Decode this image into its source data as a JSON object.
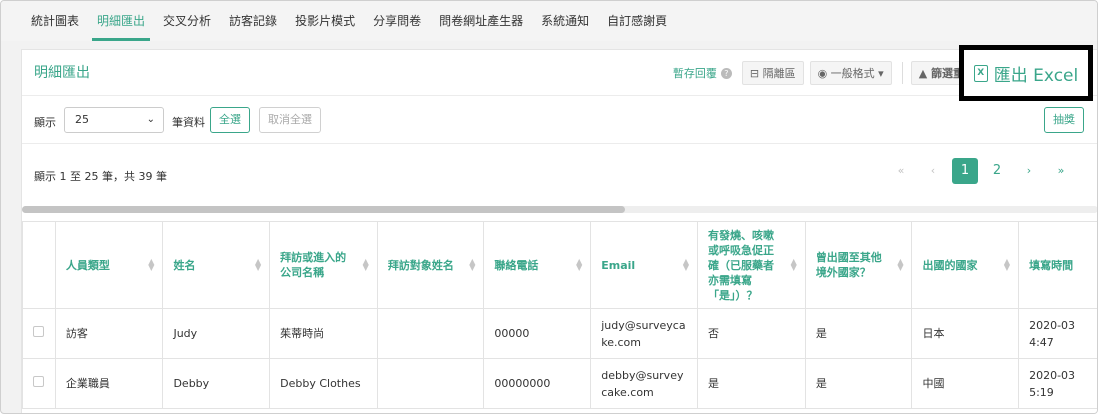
{
  "tabs": [
    "統計圖表",
    "明細匯出",
    "交叉分析",
    "訪客記錄",
    "投影片模式",
    "分享問卷",
    "問卷網址產生器",
    "系統通知",
    "自訂感謝頁"
  ],
  "active_tab_index": 1,
  "panel": {
    "title": "明細匯出",
    "tools": {
      "temp_reply": "暫存回覆",
      "help": "?",
      "separator_area": "⊟ 隔離區",
      "format": "◉ 一般格式 ▾",
      "filter": "▲ 篩選重"
    },
    "export_label": "匯出 Excel",
    "export_icon_letter": "X"
  },
  "controls": {
    "show_label": "顯示",
    "page_size": "25",
    "records_label": "筆資料",
    "select_all": "全選",
    "deselect_all": "取消全選",
    "lottery": "抽獎"
  },
  "info_text": "顯示 1 至 25 筆，共 39 筆",
  "pagination": {
    "first": "«",
    "prev": "‹",
    "pages": [
      "1",
      "2"
    ],
    "active": "1",
    "next": "›",
    "last": "»"
  },
  "scroll_fraction": 0.56,
  "table": {
    "columns": [
      "人員類型",
      "姓名",
      "拜訪或進入的公司名稱",
      "拜訪對象姓名",
      "聯絡電話",
      "Email",
      "有發燒、咳嗽或呼吸急促正確（已服藥者亦需填寫「是」）？",
      "曾出國至其他境外國家？",
      "出國的國家",
      "填寫時間"
    ],
    "rows": [
      [
        "訪客",
        "Judy",
        "茱蒂時尚",
        "",
        "00000",
        "judy@surveycake.com",
        "否",
        "是",
        "日本",
        "2020-03 4:47"
      ],
      [
        "企業職員",
        "Debby",
        "Debby Clothes",
        "",
        "00000000",
        "debby@surveycake.com",
        "是",
        "是",
        "中國",
        "2020-03 5:19"
      ]
    ]
  },
  "colors": {
    "accent": "#3aa68a"
  },
  "icons": {
    "help": "question-circle-icon",
    "export": "excel-file-icon",
    "sort": "sort-arrows-icon"
  }
}
